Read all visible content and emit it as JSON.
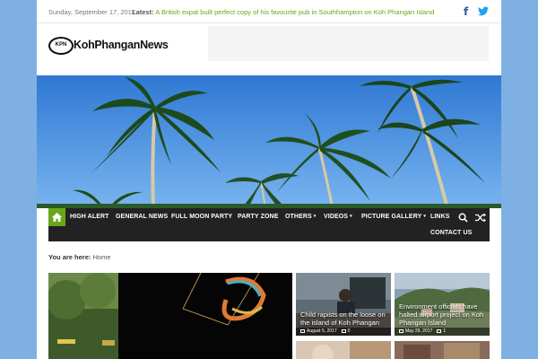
{
  "topbar": {
    "date": "Sunday, September 17, 2017",
    "latest_label": "Latest:",
    "latest_headline": "A British expat built perfect copy of his favourite pub in Southhampton on Koh Phangan Island"
  },
  "logo": {
    "mark": "KPN",
    "name": "KohPhanganNews"
  },
  "nav": {
    "items": [
      "HIGH ALERT",
      "GENERAL NEWS",
      "FULL MOON PARTY",
      "PARTY ZONE",
      "OTHERS",
      "VIDEOS",
      "PICTURE GALLERY",
      "LINKS",
      "CONTACT US"
    ],
    "dropdown_caret": "▾"
  },
  "breadcrumb": {
    "label": "You are here:",
    "current": "Home"
  },
  "posts": [
    {
      "title": "Child rapists on the loose on the island of Koh Phangan",
      "date": "August 5, 2017",
      "comments": "0"
    },
    {
      "title": "Environment officials have halted airport project on Koh Phangan Island",
      "date": "May 29, 2017",
      "comments": "1"
    }
  ],
  "colors": {
    "accent": "#6aa51c",
    "nav_bg": "#222222",
    "body_bg": "#7fb0e3"
  },
  "icons": {
    "facebook": "f",
    "home": "home-icon",
    "search": "search-icon",
    "shuffle": "shuffle-icon"
  }
}
